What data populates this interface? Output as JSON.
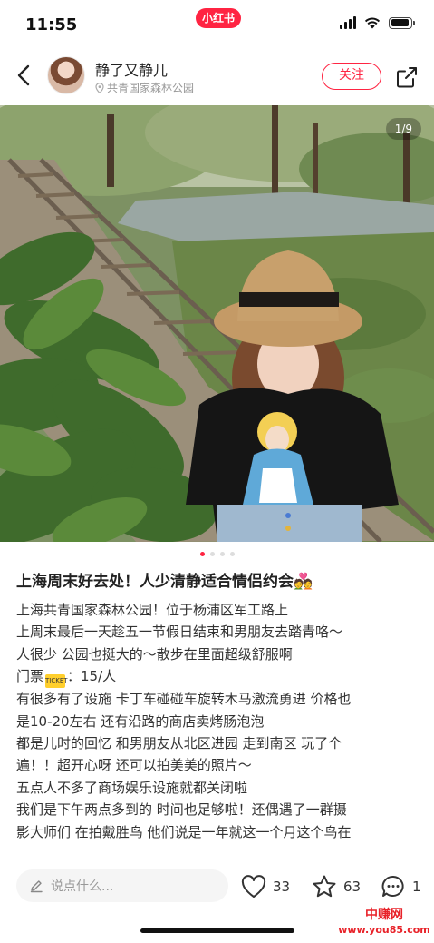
{
  "status": {
    "time": "11:55",
    "app_badge": "小红书"
  },
  "header": {
    "author_name": "静了又静儿",
    "location": "共青国家森林公园",
    "follow_label": "关注"
  },
  "photo": {
    "counter": "1/9",
    "dots_total": 4,
    "dots_active": 1
  },
  "post": {
    "title": "上海周末好去处！人少清静适合情侣约会💑",
    "ticket_icon_text": "TICKET",
    "lines": [
      "上海共青国家森林公园！位于杨浦区军工路上",
      "上周末最后一天趁五一节假日结束和男朋友去踏青咯～",
      "人很少 公园也挺大的～散步在里面超级舒服啊",
      "门票：15/人",
      "有很多有了设施 卡丁车碰碰车旋转木马激流勇进 价格也",
      "是10-20左右 还有沿路的商店卖烤肠泡泡",
      "都是儿时的回忆 和男朋友从北区进园 走到南区 玩了个",
      "遍！！超开心呀 还可以拍美美的照片～",
      "五点人不多了商场娱乐设施就都关闭啦",
      "我们是下午两点多到的 时间也足够啦！还偶遇了一群摄",
      "影大师们 在拍戴胜鸟 他们说是一年就这一个月这个鸟在"
    ],
    "ticket_prefix": "门票",
    "ticket_suffix": "：15/人"
  },
  "bottom": {
    "comment_placeholder": "说点什么...",
    "likes": "33",
    "collects": "63",
    "comments": "1"
  },
  "watermark": {
    "top": "中赚网",
    "bottom": "www.you85.com"
  },
  "colors": {
    "accent": "#ff2442",
    "watermark": "#e8232a"
  }
}
